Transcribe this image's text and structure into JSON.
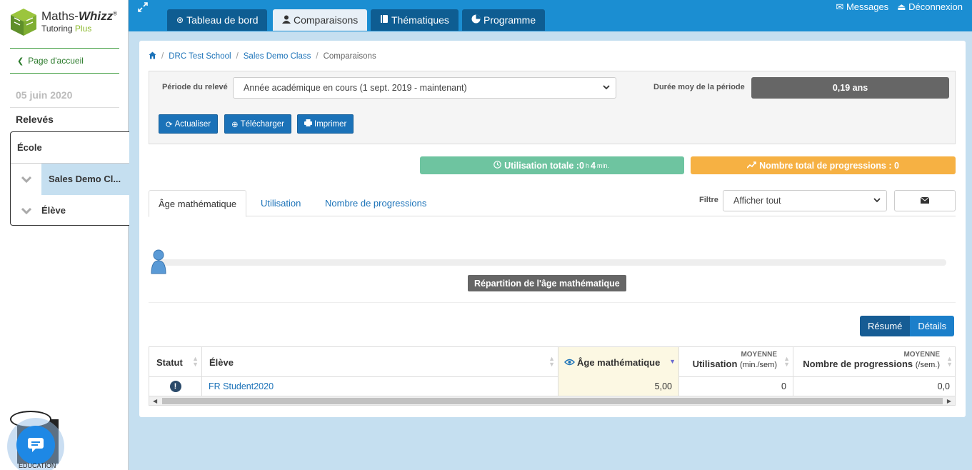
{
  "brand": {
    "name_prefix": "Maths-",
    "name_bold": "Whizz",
    "reg": "®",
    "tutoring": "Tutoring",
    "plus": "Plus"
  },
  "sidebar": {
    "home_link": "Page d'accueil",
    "date": "05 juin 2020",
    "section_title": "Relevés",
    "items": [
      {
        "label": "École"
      },
      {
        "label": "Sales Demo Cl..."
      },
      {
        "label": "Élève"
      }
    ],
    "chat_caption": "EDUCATION"
  },
  "topnav": {
    "tabs": [
      {
        "label": "Tableau de bord",
        "icon": "dashboard-icon"
      },
      {
        "label": "Comparaisons",
        "icon": "user-icon",
        "active": true
      },
      {
        "label": "Thématiques",
        "icon": "book-icon"
      },
      {
        "label": "Programme",
        "icon": "pie-icon"
      }
    ],
    "messages": "Messages",
    "logout": "Déconnexion"
  },
  "breadcrumb": [
    "DRC Test School",
    "Sales Demo Class",
    "Comparaisons"
  ],
  "filters": {
    "period_label": "Période du relevé",
    "period_value": "Année académique en cours (1 sept. 2019 - maintenant)",
    "duration_label": "Durée moy de la période",
    "duration_value": "0,19 ans",
    "refresh": "Actualiser",
    "download": "Télécharger",
    "print": "Imprimer"
  },
  "stats": {
    "usage_prefix": "Utilisation totale : ",
    "usage_hours": "0",
    "usage_h_unit": "h",
    "usage_minutes": "4",
    "usage_min_unit": "min.",
    "progress_label": "Nombre total de progressions : 0"
  },
  "tabs": [
    {
      "label": "Âge mathématique",
      "active": true
    },
    {
      "label": "Utilisation"
    },
    {
      "label": "Nombre de progressions"
    }
  ],
  "filter_label": "Filtre",
  "filter_value": "Afficher tout",
  "distribution_title": "Répartition de l'âge mathématique",
  "view_toggle": {
    "summary": "Résumé",
    "details": "Détails"
  },
  "table": {
    "headers": {
      "status": "Statut",
      "student": "Élève",
      "math_age": "Âge mathématique",
      "usage_top": "MOYENNE",
      "usage": "Utilisation",
      "usage_unit": "(min./sem)",
      "progress_top": "MOYENNE",
      "progress": "Nombre de progressions",
      "progress_unit": "(/sem.)"
    },
    "rows": [
      {
        "status": "!",
        "student": "FR Student2020",
        "math_age": "5,00",
        "usage": "0",
        "progress": "0,0"
      }
    ]
  },
  "colors": {
    "topbar": "#1b8ed2",
    "usage_badge": "#6ec4a0",
    "progress_badge": "#f6b143",
    "link": "#1b72b8"
  }
}
